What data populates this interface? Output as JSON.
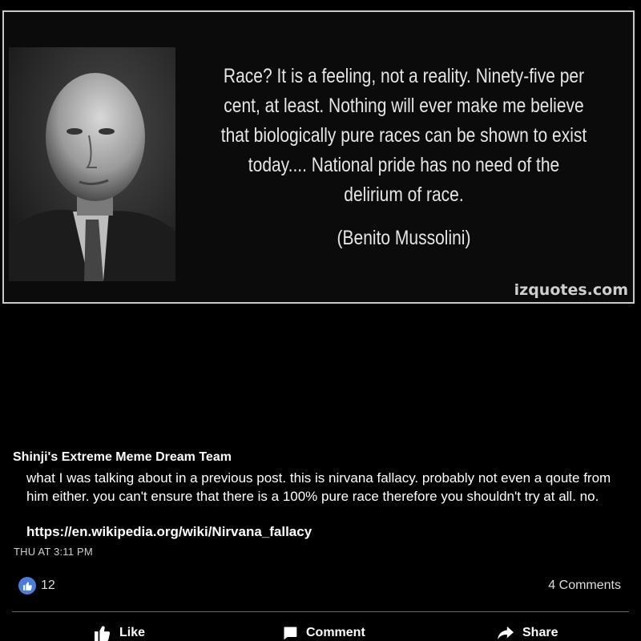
{
  "quote_image": {
    "quote": "Race? It is a feeling, not a reality. Ninety-five per cent, at least. Nothing will ever make me believe that biologically pure races can be shown to exist today.... National pride has no need of the delirium of race.",
    "author": "(Benito Mussolini)",
    "watermark": "izquotes.com"
  },
  "post": {
    "author": "Shinji's Extreme Meme Dream Team",
    "body": "what I was talking about in a previous post. this is nirvana fallacy. probably not even a qoute from him either. you can't ensure that there is a 100% pure race therefore you shouldn't try at all. no.",
    "link": "https://en.wikipedia.org/wiki/Nirvana_fallacy",
    "timestamp": "THU AT 3:11 PM"
  },
  "reactions": {
    "icon": "thumbs-up-icon",
    "count": "12",
    "comments": "4 Comments"
  },
  "actions": {
    "like_label": "Like",
    "comment_label": "Comment",
    "share_label": "Share"
  },
  "colors": {
    "background": "#000000",
    "like_badge": "#4a7dd9",
    "frame_border": "#c9c9c9"
  }
}
